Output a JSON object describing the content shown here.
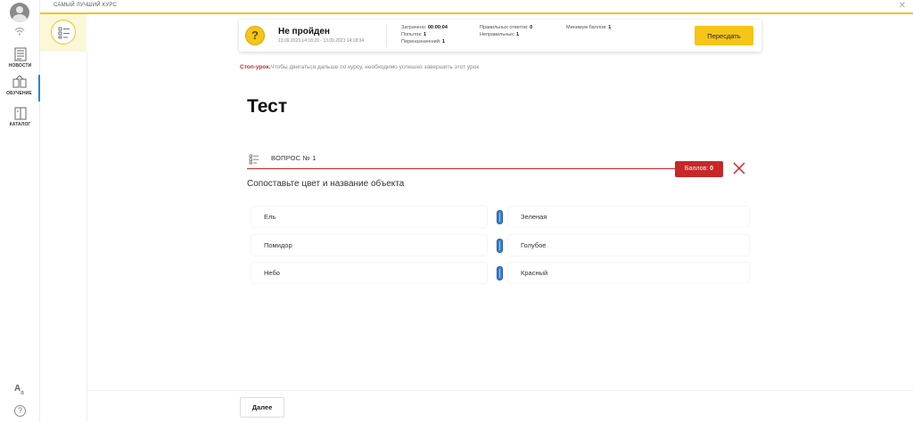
{
  "course": {
    "title": "САМЫЙ ЛУЧШИЙ КУРС"
  },
  "nav": {
    "items": [
      {
        "label": "НОВОСТИ"
      },
      {
        "label": "ОБУЧЕНИЕ"
      },
      {
        "label": "КАТАЛОГ"
      }
    ],
    "active": "ОБУЧЕНИЕ"
  },
  "result": {
    "status": "Не пройден",
    "dates": "13.09.2023 14:18:29 - 13.09.2023 14:18:34",
    "spent_label": "Затрачено:",
    "spent_value": "00:00:04",
    "attempts_label": "Попыток:",
    "attempts_value": "1",
    "reassign_label": "Переназначений:",
    "reassign_value": "1",
    "correct_label": "Правильных ответов:",
    "correct_value": "0",
    "wrong_label": "Неправильных:",
    "wrong_value": "1",
    "min_label": "Минимум баллов:",
    "min_value": "1",
    "retry_button": "Пересдать"
  },
  "stop": {
    "label": "Стоп-урок.",
    "text": "Чтобы двигаться дальше по курсу, необходимо успешно завершить этот урок"
  },
  "test": {
    "title": "Тест"
  },
  "question": {
    "label": "ВОПРОС № 1",
    "score_label": "Баллов:",
    "score_value": "0",
    "text": "Сопоставьте цвет и название объекта",
    "pairs": [
      {
        "left": "Ель",
        "right": "Зеленая"
      },
      {
        "left": "Помидор",
        "right": "Голубое"
      },
      {
        "left": "Небо",
        "right": "Красный"
      }
    ]
  },
  "footer": {
    "next_button": "Далее"
  },
  "colors": {
    "accent": "#f5c518",
    "error": "#c62828",
    "handle": "#3a7fcf"
  }
}
